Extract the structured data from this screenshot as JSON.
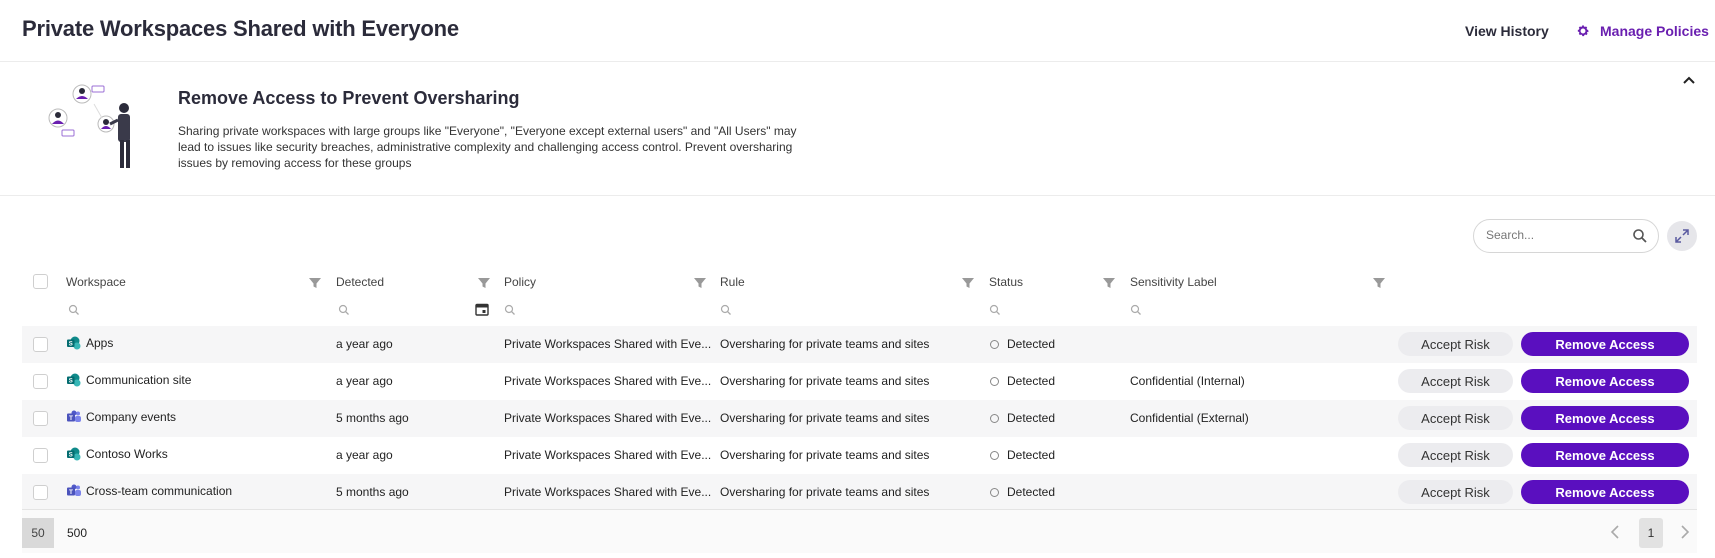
{
  "header": {
    "title": "Private Workspaces Shared with Everyone",
    "view_history": "View History",
    "manage_policies": "Manage Policies"
  },
  "banner": {
    "title": "Remove Access to Prevent Oversharing",
    "text": "Sharing private workspaces with large groups like \"Everyone\", \"Everyone except external users\" and \"All Users\" may lead to issues like security breaches, administrative complexity and challenging access control. Prevent oversharing issues by removing access for these groups"
  },
  "toolbar": {
    "search_placeholder": "Search..."
  },
  "table": {
    "columns": [
      "Workspace",
      "Detected",
      "Policy",
      "Rule",
      "Status",
      "Sensitivity Label"
    ],
    "rows": [
      {
        "workspace": "Apps",
        "icon": "sharepoint-icon",
        "detected": "a year ago",
        "policy": "Private Workspaces Shared with Eve...",
        "rule": "Oversharing for private teams and sites",
        "status": "Detected",
        "label": ""
      },
      {
        "workspace": "Communication site",
        "icon": "sharepoint-icon",
        "detected": "a year ago",
        "policy": "Private Workspaces Shared with Eve...",
        "rule": "Oversharing for private teams and sites",
        "status": "Detected",
        "label": "Confidential (Internal)"
      },
      {
        "workspace": "Company events",
        "icon": "teams-icon",
        "detected": "5 months ago",
        "policy": "Private Workspaces Shared with Eve...",
        "rule": "Oversharing for private teams and sites",
        "status": "Detected",
        "label": "Confidential (External)"
      },
      {
        "workspace": "Contoso Works",
        "icon": "sharepoint-icon",
        "detected": "a year ago",
        "policy": "Private Workspaces Shared with Eve...",
        "rule": "Oversharing for private teams and sites",
        "status": "Detected",
        "label": ""
      },
      {
        "workspace": "Cross-team communication",
        "icon": "teams-icon",
        "detected": "5 months ago",
        "policy": "Private Workspaces Shared with Eve...",
        "rule": "Oversharing for private teams and sites",
        "status": "Detected",
        "label": ""
      }
    ],
    "accept_label": "Accept Risk",
    "remove_label": "Remove Access"
  },
  "footer": {
    "page_sizes": [
      "50",
      "500"
    ],
    "current_page": "1"
  },
  "colors": {
    "accent": "#6a1fb0",
    "primary_button": "#5a0fbf",
    "sharepoint": "#0f8a8a",
    "teams": "#5b5fc7"
  }
}
